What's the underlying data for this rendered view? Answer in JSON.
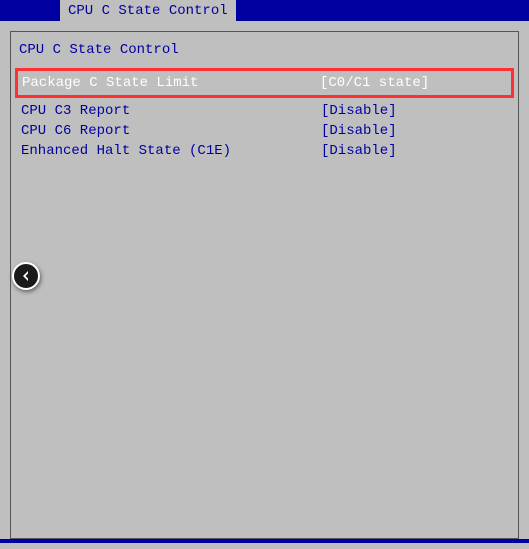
{
  "header": {
    "tab_label": "CPU C State Control"
  },
  "section": {
    "title": "CPU C State Control"
  },
  "highlighted": {
    "label": "Package C State Limit",
    "value": "[C0/C1 state]"
  },
  "settings": [
    {
      "label": "CPU C3 Report",
      "value": "[Disable]"
    },
    {
      "label": "CPU C6 Report",
      "value": "[Disable]"
    },
    {
      "label": "Enhanced Halt State (C1E)",
      "value": "[Disable]"
    }
  ]
}
